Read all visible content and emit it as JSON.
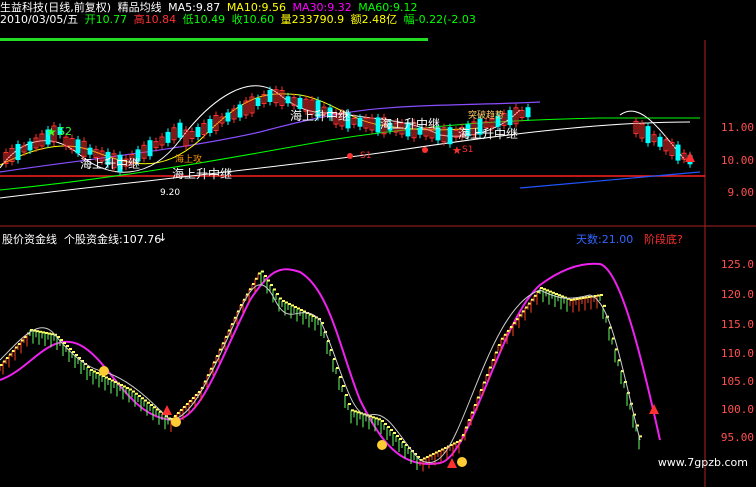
{
  "header": {
    "line1": {
      "stock": "生益科技(日线,前复权)",
      "indicator": "精品均线",
      "ma5": "MA5:9.87",
      "ma10": "MA10:9.56",
      "ma30": "MA30:9.32",
      "ma60": "MA60:9.12"
    },
    "line2": {
      "date": "2010/03/05/五",
      "open": "开10.77",
      "high": "高10.84",
      "low": "低10.49",
      "close": "收10.60",
      "volume": "量233790.9",
      "amount": "额2.48亿",
      "change": "幅-0.22(-2.03"
    }
  },
  "main_axis": [
    "11.00",
    "10.00",
    "9.00"
  ],
  "main_labels": {
    "s2": "S2",
    "continue1": "海上升中继",
    "continue2": "海上升中继",
    "continue3": "海上升中继",
    "continue4": "海上升中继",
    "continue5": "海上升中继",
    "small1": "海上攻",
    "small2": "S1",
    "small3": "S1",
    "small4": "突破趋势",
    "price_low": "9.20"
  },
  "sub_header": {
    "title": "股价资金线",
    "value": "个股资金线:107.76",
    "arrow": "↓",
    "tianji": "天数:21.00",
    "stage": "阶段底?"
  },
  "sub_axis": [
    "125.0",
    "120.0",
    "115.0",
    "110.0",
    "105.0",
    "100.0",
    "95.00"
  ],
  "watermark": "www.7gpzb.com",
  "colors": {
    "ma5": "#ffffff",
    "ma10": "#ffff00",
    "ma30": "#ff00ff",
    "ma60": "#00ff00",
    "up": "#ff3030",
    "down": "#00ffff",
    "accent": "#ff3030"
  }
}
